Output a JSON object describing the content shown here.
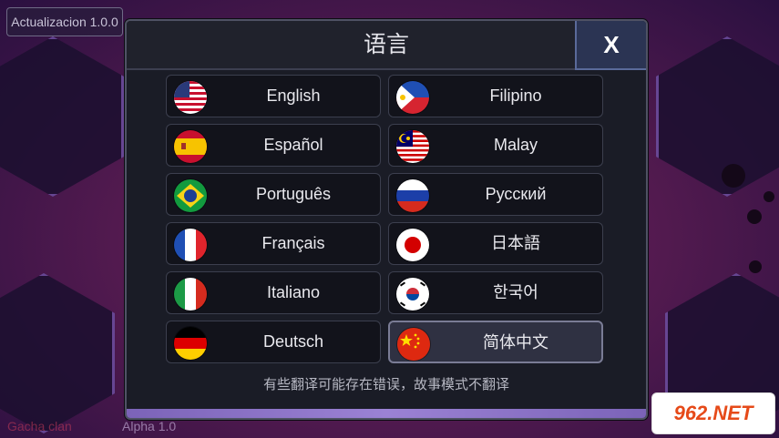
{
  "version_label": "Actualizacion 1.0.0",
  "brand_text": "Gacha clan",
  "alpha_text": "Alpha 1.0",
  "watermark_text": "962.NET",
  "dialog": {
    "title": "语言",
    "close_label": "X",
    "notice": "有些翻译可能存在错误，故事模式不翻译"
  },
  "languages": [
    {
      "label": "English",
      "flag": "us-flag-icon"
    },
    {
      "label": "Filipino",
      "flag": "philippines-flag-icon"
    },
    {
      "label": "Español",
      "flag": "spain-flag-icon"
    },
    {
      "label": "Malay",
      "flag": "malaysia-flag-icon"
    },
    {
      "label": "Português",
      "flag": "brazil-flag-icon"
    },
    {
      "label": "Русский",
      "flag": "russia-flag-icon"
    },
    {
      "label": "Français",
      "flag": "france-flag-icon"
    },
    {
      "label": "日本語",
      "flag": "japan-flag-icon"
    },
    {
      "label": "Italiano",
      "flag": "italy-flag-icon"
    },
    {
      "label": "한국어",
      "flag": "korea-flag-icon"
    },
    {
      "label": "Deutsch",
      "flag": "germany-flag-icon"
    },
    {
      "label": "简体中文",
      "flag": "china-flag-icon",
      "selected": true
    }
  ],
  "colors": {
    "dialog_bg": "#1a1c26",
    "button_bg": "#12131b",
    "selected_bg": "#2f3142",
    "close_bg": "#2b3453",
    "footer_accent": "#9b82d4"
  }
}
